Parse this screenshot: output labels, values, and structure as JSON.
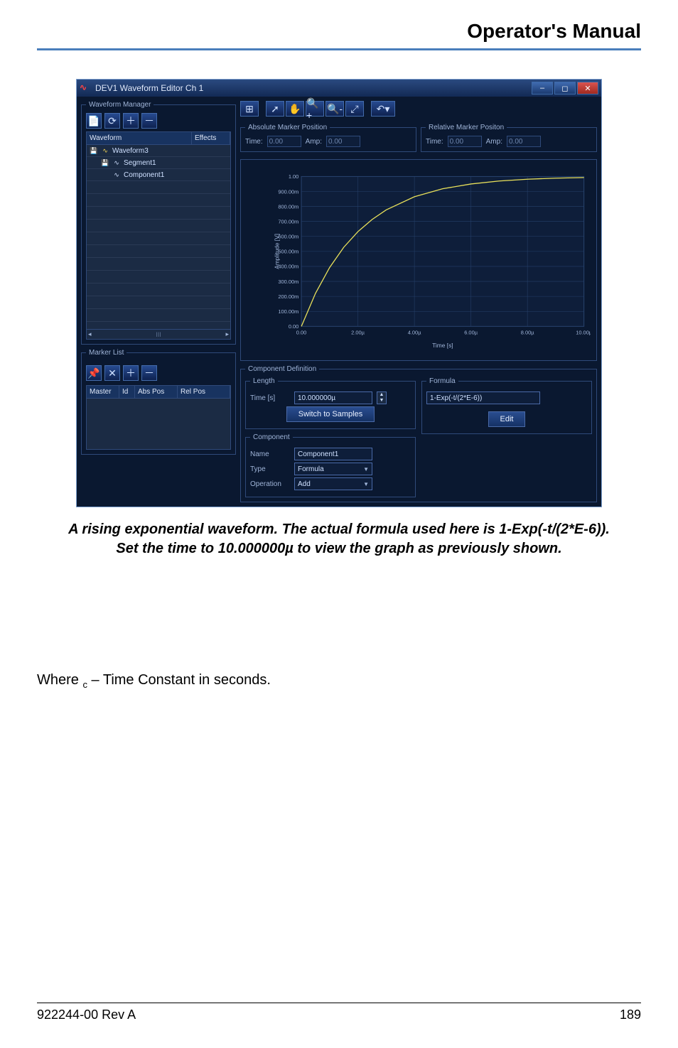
{
  "doc": {
    "header_title": "Operator's Manual",
    "caption_line1": "A rising exponential waveform. The actual formula used here is 1-Exp(-t/(2*E-6)).",
    "caption_line2": "Set the time to 10.000000µ to view the graph as previously shown.",
    "where_prefix": "Where   ",
    "where_sub": "c",
    "where_rest": " – Time Constant in seconds.",
    "footer_left": "922244-00 Rev A",
    "footer_right": "189"
  },
  "window": {
    "title": "DEV1 Waveform Editor Ch 1"
  },
  "waveform_manager": {
    "legend": "Waveform Manager",
    "col_name": "Waveform",
    "col_effects": "Effects",
    "tree": {
      "root": "Waveform3",
      "seg": "Segment1",
      "comp": "Component1"
    }
  },
  "marker_list": {
    "legend": "Marker List",
    "cols": {
      "c1": "Master",
      "c2": "Id",
      "c3": "Abs Pos",
      "c4": "Rel Pos"
    }
  },
  "abs_marker": {
    "legend": "Absolute Marker Position",
    "time_label": "Time:",
    "time_val": "0.00",
    "amp_label": "Amp:",
    "amp_val": "0.00"
  },
  "rel_marker": {
    "legend": "Relative Marker Positon",
    "time_label": "Time:",
    "time_val": "0.00",
    "amp_label": "Amp:",
    "amp_val": "0.00"
  },
  "comp_def": {
    "legend": "Component Definition",
    "length_legend": "Length",
    "time_label": "Time [s]",
    "time_val": "10.000000µ",
    "switch_btn": "Switch to Samples",
    "component_legend": "Component",
    "name_label": "Name",
    "name_val": "Component1",
    "type_label": "Type",
    "type_val": "Formula",
    "op_label": "Operation",
    "op_val": "Add",
    "formula_legend": "Formula",
    "formula_val": "1-Exp(-t/(2*E-6))",
    "edit_btn": "Edit"
  },
  "chart_data": {
    "type": "line",
    "title": "",
    "xlabel": "Time [s]",
    "ylabel": "Amplitude [V]",
    "xlim": [
      0,
      1e-05
    ],
    "ylim": [
      0,
      1.0
    ],
    "x_ticks_labels": [
      "0.00",
      "2.00µ",
      "4.00µ",
      "6.00µ",
      "8.00µ",
      "10.00µ"
    ],
    "y_ticks_labels": [
      "0.00",
      "100.00m",
      "200.00m",
      "300.00m",
      "400.00m",
      "500.00m",
      "600.00m",
      "700.00m",
      "800.00m",
      "900.00m",
      "1.00"
    ],
    "x": [
      0,
      5e-07,
      1e-06,
      1.5e-06,
      2e-06,
      2.5e-06,
      3e-06,
      4e-06,
      5e-06,
      6e-06,
      7e-06,
      8e-06,
      9e-06,
      1e-05
    ],
    "y": [
      0.0,
      0.221,
      0.393,
      0.528,
      0.632,
      0.713,
      0.777,
      0.865,
      0.918,
      0.95,
      0.97,
      0.982,
      0.989,
      0.993
    ]
  }
}
